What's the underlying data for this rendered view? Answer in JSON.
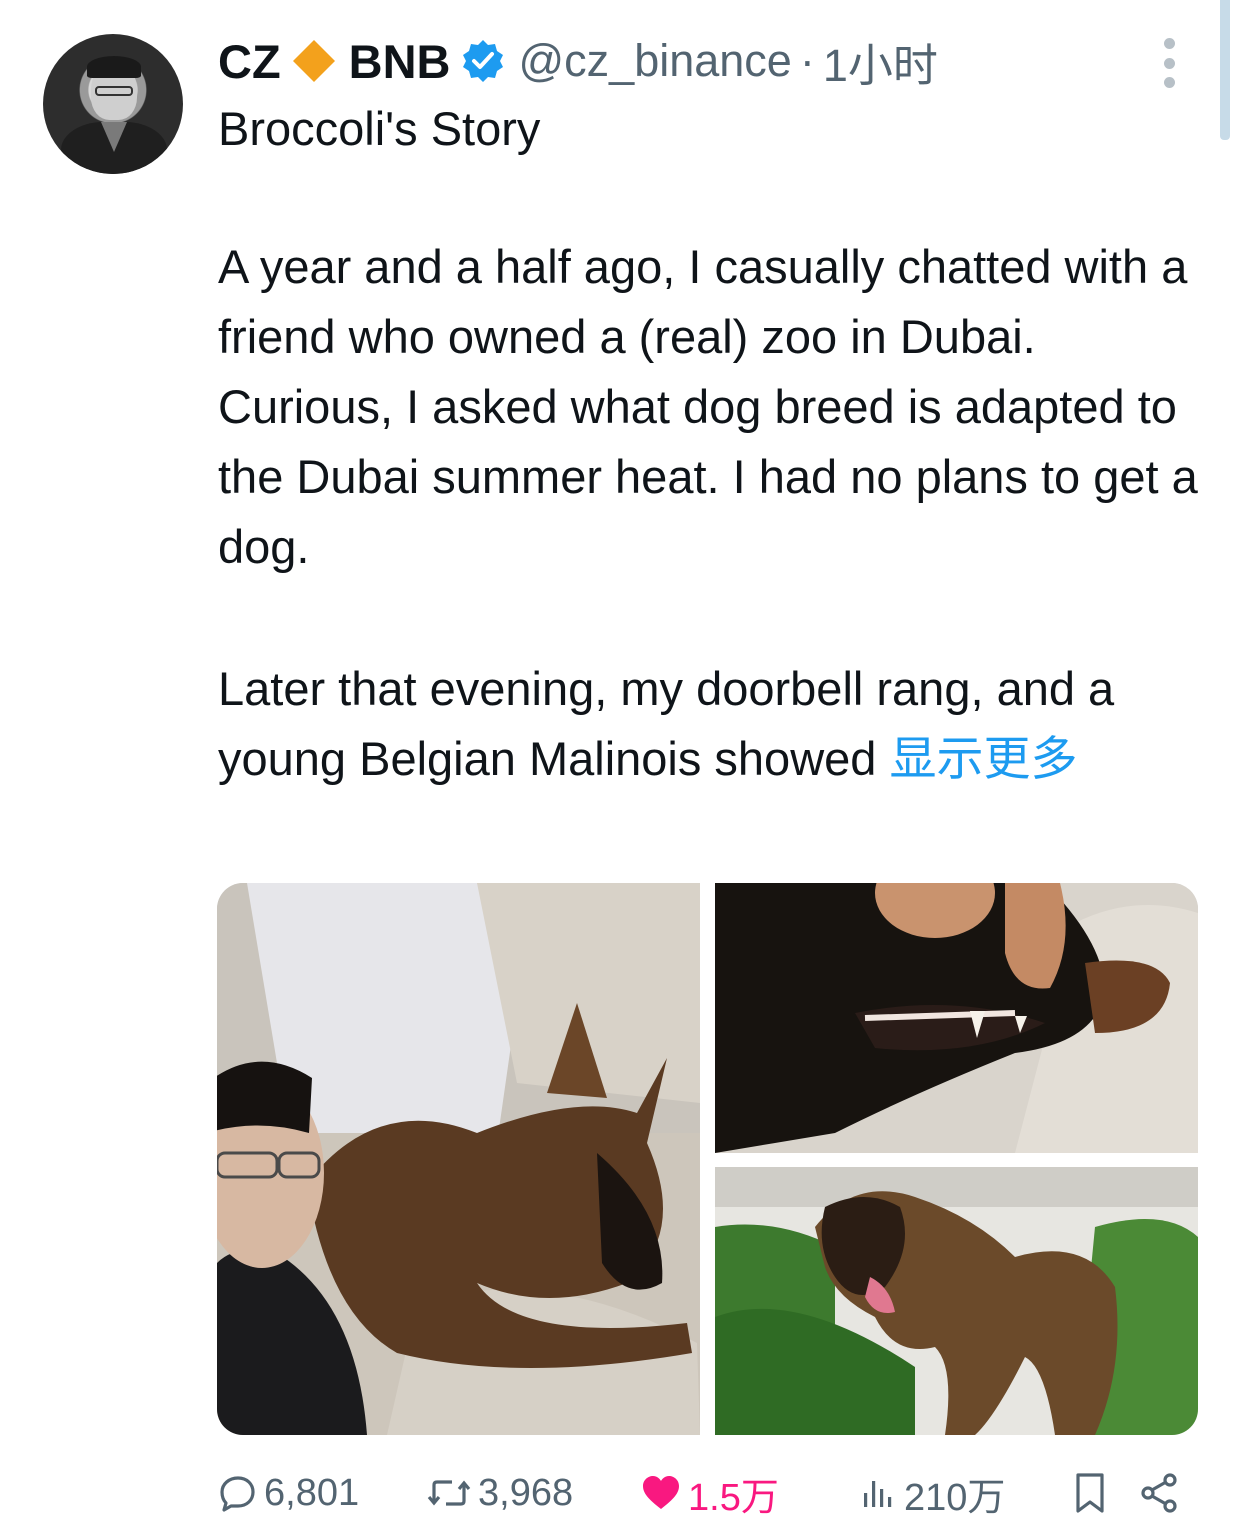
{
  "tweet": {
    "author_name": "CZ",
    "author_badge_icon": "orange-diamond-icon",
    "author_suffix": "BNB",
    "verified_icon": "verified-badge-icon",
    "handle": "@cz_binance",
    "separator": "·",
    "time": "1小时",
    "title": "Broccoli's Story",
    "paragraph1": "A year and a half ago, I casually chatted with a friend who owned a (real) zoo in Dubai. Curious, I asked what dog breed is adapted to the Dubai summer heat. I had no plans to get a dog.",
    "paragraph2": "Later that evening, my doorbell rang, and a young Belgian Malinois showed ",
    "show_more": "显示更多"
  },
  "actions": {
    "replies": "6,801",
    "retweets": "3,968",
    "likes": "1.5万",
    "views": "210万"
  },
  "colors": {
    "accent": "#1d9bf0",
    "like": "#f91880",
    "muted": "#536471",
    "bnb": "#f3a11c"
  }
}
